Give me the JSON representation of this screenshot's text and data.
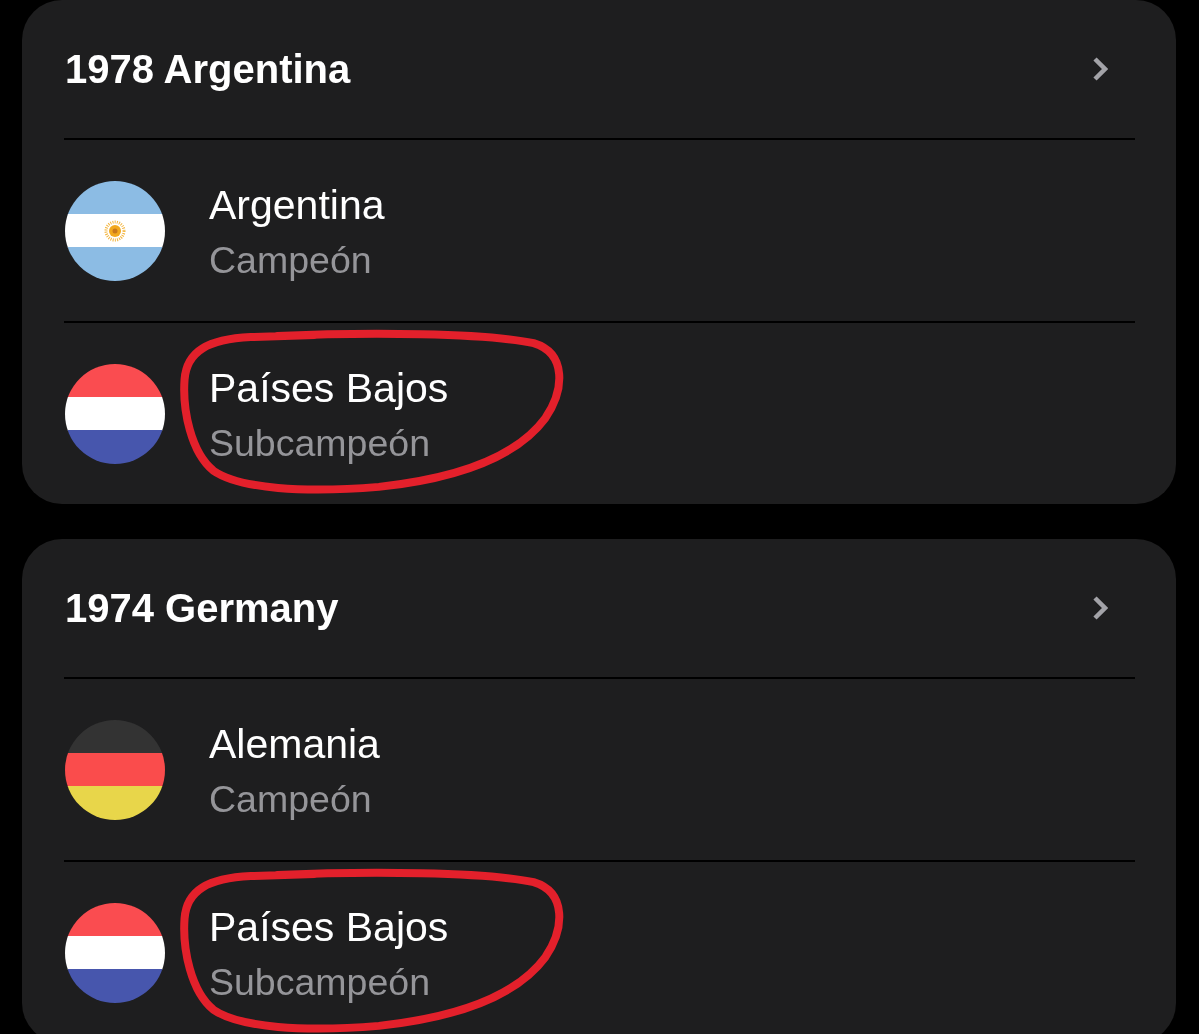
{
  "sections": [
    {
      "title": "1978 Argentina",
      "rows": [
        {
          "kind": "argentina",
          "name": "Argentina",
          "result": "Campeón",
          "circled": false
        },
        {
          "kind": "netherlands",
          "name": "Países Bajos",
          "result": "Subcampeón",
          "circled": true
        }
      ]
    },
    {
      "title": "1974 Germany",
      "rows": [
        {
          "kind": "germany",
          "name": "Alemania",
          "result": "Campeón",
          "circled": false
        },
        {
          "kind": "netherlands",
          "name": "Países Bajos",
          "result": "Subcampeón",
          "circled": true
        }
      ]
    }
  ]
}
